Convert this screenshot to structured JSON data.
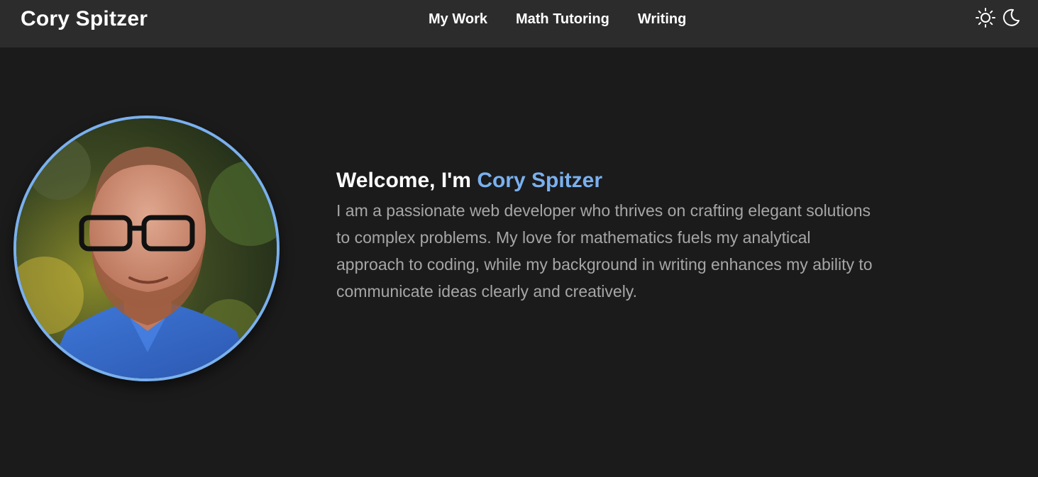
{
  "header": {
    "brand": "Cory Spitzer",
    "nav": [
      {
        "label": "My Work"
      },
      {
        "label": "Math Tutoring"
      },
      {
        "label": "Writing"
      }
    ],
    "theme_icons": [
      "sun-icon",
      "moon-icon"
    ]
  },
  "hero": {
    "greeting": "Welcome, I'm ",
    "name": "Cory Spitzer",
    "bio": "I am a passionate web developer who thrives on crafting elegant solutions to complex problems. My love for mathematics fuels my analytical approach to coding, while my background in writing enhances my ability to communicate ideas clearly and creatively."
  },
  "colors": {
    "background": "#1b1b1b",
    "header": "#2c2c2c",
    "accent": "#7ab0ee",
    "body_text": "#a6a6a6"
  }
}
